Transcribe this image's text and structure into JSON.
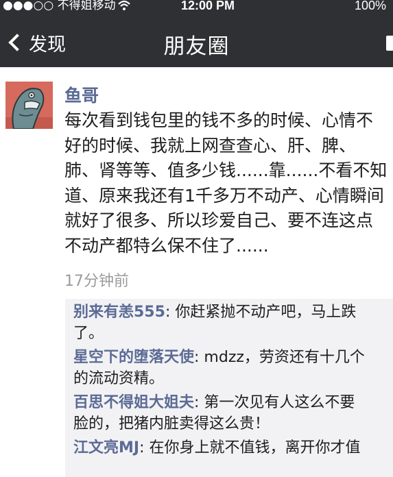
{
  "status_bar": {
    "carrier": "●●●○○ 不得姐移动",
    "time": "12:00 PM",
    "battery": "100%"
  },
  "nav": {
    "back_label": "发现",
    "title": "朋友圈"
  },
  "post": {
    "author": "鱼哥",
    "lines": [
      "每次看到钱包里的钱不多的时候、心情不",
      "好的时候、我就上网查查心、肝、脾、",
      "肺、肾等等、值多少钱......靠......不看不知",
      "道、原来我还有1千多万不动产、心情瞬间",
      "就好了很多、所以珍爱自己、要不连这点",
      "不动产都特么保不住了......"
    ],
    "time_ago": "17分钟前"
  },
  "comments": [
    {
      "name": "别来有恙555",
      "first": "你赶紧抛不动产吧，马上跌",
      "second": "了。"
    },
    {
      "name": "星空下的堕落天使",
      "first": "mdzz，劳资还有十几个",
      "second": "的流动资精。"
    },
    {
      "name": "百思不得姐大姐夫",
      "first": "第一次见有人这么不要",
      "second": "脸的，把猪内脏卖得这么贵！"
    },
    {
      "name": "江文亮MJ",
      "first": "在你身上就不值钱，离开你才值",
      "second": ""
    }
  ]
}
